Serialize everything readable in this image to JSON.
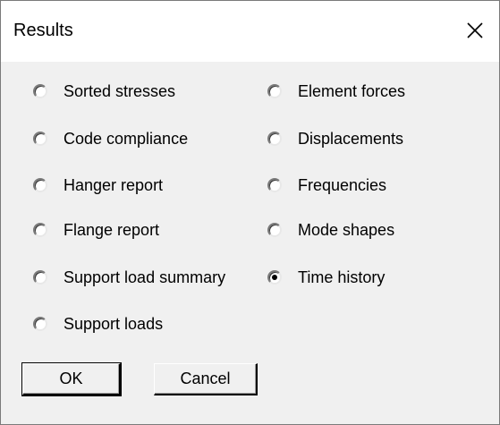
{
  "window": {
    "title": "Results",
    "close_symbol": "✕",
    "close_icon": "close-icon"
  },
  "options": {
    "left": [
      {
        "label": "Sorted stresses",
        "checked": false
      },
      {
        "label": "Code compliance",
        "checked": false
      },
      {
        "label": "Hanger report",
        "checked": false
      },
      {
        "label": "Flange report",
        "checked": false
      },
      {
        "label": "Support load summary",
        "checked": false
      },
      {
        "label": "Support loads",
        "checked": false
      }
    ],
    "right": [
      {
        "label": "Element forces",
        "checked": false
      },
      {
        "label": "Displacements",
        "checked": false
      },
      {
        "label": "Frequencies",
        "checked": false
      },
      {
        "label": "Mode shapes",
        "checked": false
      },
      {
        "label": "Time history",
        "checked": true
      }
    ]
  },
  "buttons": {
    "ok_label": "OK",
    "cancel_label": "Cancel"
  },
  "colors": {
    "dialog_bg": "#f0f0f0",
    "titlebar_bg": "#ffffff",
    "text": "#000000"
  }
}
